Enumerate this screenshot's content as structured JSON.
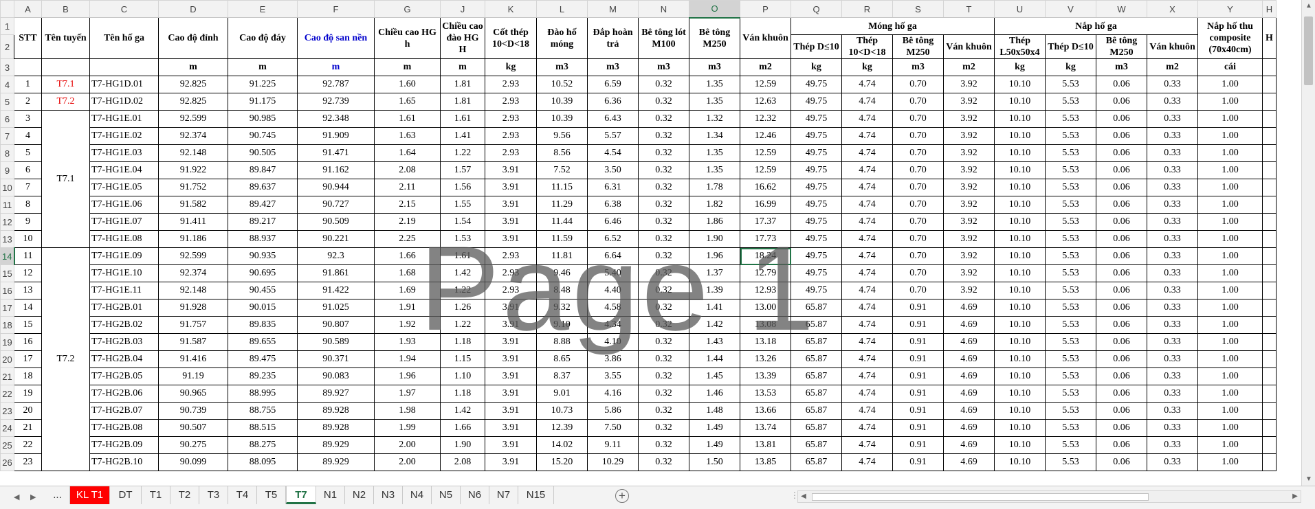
{
  "columns": [
    "A",
    "B",
    "C",
    "D",
    "E",
    "F",
    "G",
    "J",
    "K",
    "L",
    "M",
    "N",
    "O",
    "P",
    "Q",
    "R",
    "S",
    "T",
    "U",
    "V",
    "W",
    "X",
    "Y",
    "H"
  ],
  "row_numbers": [
    "1",
    "2",
    "3",
    "4",
    "5",
    "6",
    "7",
    "8",
    "9",
    "10",
    "11",
    "12",
    "13",
    "14",
    "15",
    "16",
    "17",
    "18",
    "19",
    "20",
    "21",
    "22",
    "23",
    "24",
    "25",
    "26"
  ],
  "header": {
    "stt": "STT",
    "ten_tuyen": "Tên tuyến",
    "ten_ho_ga": "Tên hố ga",
    "cao_do_dinh": "Cao độ đỉnh",
    "cao_do_day": "Cao độ đáy",
    "cao_do_san_nen": "Cao độ san nền",
    "chieu_cao_hg_h": "Chiều cao HG h",
    "chieu_cao_dao": "Chiều cao đào HG H",
    "cot_thep": "Cốt thép 10<D<18",
    "dao_ho_mong": "Đào hố móng",
    "dap_hoan_tra": "Đắp hoàn trả",
    "be_tong_lot": "Bê tông lót M100",
    "be_tong_m250": "Bê tông M250",
    "van_khuon": "Ván khuôn",
    "mong_ho_ga": "Móng hố ga",
    "nap_ho_ga": "Nắp hố ga",
    "nap_ho_thu": "Nắp hố thu composite (70x40cm)",
    "extra_h": "H",
    "sub_mong": [
      "Thép D≤10",
      "Thép 10<D<18",
      "Bê tông M250",
      "Ván khuôn"
    ],
    "sub_nap": [
      "Thép L50x50x4",
      "Thép D≤10",
      "Bê tông M250",
      "Ván khuôn"
    ]
  },
  "units": [
    "",
    "",
    "",
    "m",
    "m",
    "m",
    "m",
    "m",
    "kg",
    "m3",
    "m3",
    "m3",
    "m3",
    "m2",
    "kg",
    "kg",
    "m3",
    "m2",
    "kg",
    "kg",
    "m3",
    "m2",
    "cái"
  ],
  "groups": [
    {
      "label": "T7.1",
      "red": true,
      "start": 0,
      "span": 1
    },
    {
      "label": "T7.2",
      "red": true,
      "start": 1,
      "span": 1
    },
    {
      "label": "T7.1",
      "red": false,
      "start": 2,
      "span": 8
    },
    {
      "label": "T7.2",
      "red": false,
      "start": 10,
      "span": 13
    }
  ],
  "rows": [
    [
      "1",
      "T7-HG1D.01",
      "92.825",
      "91.225",
      "92.787",
      "1.60",
      "1.81",
      "2.93",
      "10.52",
      "6.59",
      "0.32",
      "1.35",
      "12.59",
      "49.75",
      "4.74",
      "0.70",
      "3.92",
      "10.10",
      "5.53",
      "0.06",
      "0.33",
      "1.00"
    ],
    [
      "2",
      "T7-HG1D.02",
      "92.825",
      "91.175",
      "92.739",
      "1.65",
      "1.81",
      "2.93",
      "10.39",
      "6.36",
      "0.32",
      "1.35",
      "12.63",
      "49.75",
      "4.74",
      "0.70",
      "3.92",
      "10.10",
      "5.53",
      "0.06",
      "0.33",
      "1.00"
    ],
    [
      "3",
      "T7-HG1E.01",
      "92.599",
      "90.985",
      "92.348",
      "1.61",
      "1.61",
      "2.93",
      "10.39",
      "6.43",
      "0.32",
      "1.32",
      "12.32",
      "49.75",
      "4.74",
      "0.70",
      "3.92",
      "10.10",
      "5.53",
      "0.06",
      "0.33",
      "1.00"
    ],
    [
      "4",
      "T7-HG1E.02",
      "92.374",
      "90.745",
      "91.909",
      "1.63",
      "1.41",
      "2.93",
      "9.56",
      "5.57",
      "0.32",
      "1.34",
      "12.46",
      "49.75",
      "4.74",
      "0.70",
      "3.92",
      "10.10",
      "5.53",
      "0.06",
      "0.33",
      "1.00"
    ],
    [
      "5",
      "T7-HG1E.03",
      "92.148",
      "90.505",
      "91.471",
      "1.64",
      "1.22",
      "2.93",
      "8.56",
      "4.54",
      "0.32",
      "1.35",
      "12.59",
      "49.75",
      "4.74",
      "0.70",
      "3.92",
      "10.10",
      "5.53",
      "0.06",
      "0.33",
      "1.00"
    ],
    [
      "6",
      "T7-HG1E.04",
      "91.922",
      "89.847",
      "91.162",
      "2.08",
      "1.57",
      "3.91",
      "7.52",
      "3.50",
      "0.32",
      "1.35",
      "12.59",
      "49.75",
      "4.74",
      "0.70",
      "3.92",
      "10.10",
      "5.53",
      "0.06",
      "0.33",
      "1.00"
    ],
    [
      "7",
      "T7-HG1E.05",
      "91.752",
      "89.637",
      "90.944",
      "2.11",
      "1.56",
      "3.91",
      "11.15",
      "6.31",
      "0.32",
      "1.78",
      "16.62",
      "49.75",
      "4.74",
      "0.70",
      "3.92",
      "10.10",
      "5.53",
      "0.06",
      "0.33",
      "1.00"
    ],
    [
      "8",
      "T7-HG1E.06",
      "91.582",
      "89.427",
      "90.727",
      "2.15",
      "1.55",
      "3.91",
      "11.29",
      "6.38",
      "0.32",
      "1.82",
      "16.99",
      "49.75",
      "4.74",
      "0.70",
      "3.92",
      "10.10",
      "5.53",
      "0.06",
      "0.33",
      "1.00"
    ],
    [
      "9",
      "T7-HG1E.07",
      "91.411",
      "89.217",
      "90.509",
      "2.19",
      "1.54",
      "3.91",
      "11.44",
      "6.46",
      "0.32",
      "1.86",
      "17.37",
      "49.75",
      "4.74",
      "0.70",
      "3.92",
      "10.10",
      "5.53",
      "0.06",
      "0.33",
      "1.00"
    ],
    [
      "10",
      "T7-HG1E.08",
      "91.186",
      "88.937",
      "90.221",
      "2.25",
      "1.53",
      "3.91",
      "11.59",
      "6.52",
      "0.32",
      "1.90",
      "17.73",
      "49.75",
      "4.74",
      "0.70",
      "3.92",
      "10.10",
      "5.53",
      "0.06",
      "0.33",
      "1.00"
    ],
    [
      "11",
      "T7-HG1E.09",
      "92.599",
      "90.935",
      "92.3",
      "1.66",
      "1.61",
      "2.93",
      "11.81",
      "6.64",
      "0.32",
      "1.96",
      "18.24",
      "49.75",
      "4.74",
      "0.70",
      "3.92",
      "10.10",
      "5.53",
      "0.06",
      "0.33",
      "1.00"
    ],
    [
      "12",
      "T7-HG1E.10",
      "92.374",
      "90.695",
      "91.861",
      "1.68",
      "1.42",
      "2.93",
      "9.46",
      "5.40",
      "0.32",
      "1.37",
      "12.79",
      "49.75",
      "4.74",
      "0.70",
      "3.92",
      "10.10",
      "5.53",
      "0.06",
      "0.33",
      "1.00"
    ],
    [
      "13",
      "T7-HG1E.11",
      "92.148",
      "90.455",
      "91.422",
      "1.69",
      "1.22",
      "2.93",
      "8.48",
      "4.40",
      "0.32",
      "1.39",
      "12.93",
      "49.75",
      "4.74",
      "0.70",
      "3.92",
      "10.10",
      "5.53",
      "0.06",
      "0.33",
      "1.00"
    ],
    [
      "14",
      "T7-HG2B.01",
      "91.928",
      "90.015",
      "91.025",
      "1.91",
      "1.26",
      "3.91",
      "9.32",
      "4.58",
      "0.32",
      "1.41",
      "13.00",
      "65.87",
      "4.74",
      "0.91",
      "4.69",
      "10.10",
      "5.53",
      "0.06",
      "0.33",
      "1.00"
    ],
    [
      "15",
      "T7-HG2B.02",
      "91.757",
      "89.835",
      "90.807",
      "1.92",
      "1.22",
      "3.91",
      "9.10",
      "4.34",
      "0.32",
      "1.42",
      "13.08",
      "65.87",
      "4.74",
      "0.91",
      "4.69",
      "10.10",
      "5.53",
      "0.06",
      "0.33",
      "1.00"
    ],
    [
      "16",
      "T7-HG2B.03",
      "91.587",
      "89.655",
      "90.589",
      "1.93",
      "1.18",
      "3.91",
      "8.88",
      "4.10",
      "0.32",
      "1.43",
      "13.18",
      "65.87",
      "4.74",
      "0.91",
      "4.69",
      "10.10",
      "5.53",
      "0.06",
      "0.33",
      "1.00"
    ],
    [
      "17",
      "T7-HG2B.04",
      "91.416",
      "89.475",
      "90.371",
      "1.94",
      "1.15",
      "3.91",
      "8.65",
      "3.86",
      "0.32",
      "1.44",
      "13.26",
      "65.87",
      "4.74",
      "0.91",
      "4.69",
      "10.10",
      "5.53",
      "0.06",
      "0.33",
      "1.00"
    ],
    [
      "18",
      "T7-HG2B.05",
      "91.19",
      "89.235",
      "90.083",
      "1.96",
      "1.10",
      "3.91",
      "8.37",
      "3.55",
      "0.32",
      "1.45",
      "13.39",
      "65.87",
      "4.74",
      "0.91",
      "4.69",
      "10.10",
      "5.53",
      "0.06",
      "0.33",
      "1.00"
    ],
    [
      "19",
      "T7-HG2B.06",
      "90.965",
      "88.995",
      "89.927",
      "1.97",
      "1.18",
      "3.91",
      "9.01",
      "4.16",
      "0.32",
      "1.46",
      "13.53",
      "65.87",
      "4.74",
      "0.91",
      "4.69",
      "10.10",
      "5.53",
      "0.06",
      "0.33",
      "1.00"
    ],
    [
      "20",
      "T7-HG2B.07",
      "90.739",
      "88.755",
      "89.928",
      "1.98",
      "1.42",
      "3.91",
      "10.73",
      "5.86",
      "0.32",
      "1.48",
      "13.66",
      "65.87",
      "4.74",
      "0.91",
      "4.69",
      "10.10",
      "5.53",
      "0.06",
      "0.33",
      "1.00"
    ],
    [
      "21",
      "T7-HG2B.08",
      "90.507",
      "88.515",
      "89.928",
      "1.99",
      "1.66",
      "3.91",
      "12.39",
      "7.50",
      "0.32",
      "1.49",
      "13.74",
      "65.87",
      "4.74",
      "0.91",
      "4.69",
      "10.10",
      "5.53",
      "0.06",
      "0.33",
      "1.00"
    ],
    [
      "22",
      "T7-HG2B.09",
      "90.275",
      "88.275",
      "89.929",
      "2.00",
      "1.90",
      "3.91",
      "14.02",
      "9.11",
      "0.32",
      "1.49",
      "13.81",
      "65.87",
      "4.74",
      "0.91",
      "4.69",
      "10.10",
      "5.53",
      "0.06",
      "0.33",
      "1.00"
    ],
    [
      "23",
      "T7-HG2B.10",
      "90.099",
      "88.095",
      "89.929",
      "2.00",
      "2.08",
      "3.91",
      "15.20",
      "10.29",
      "0.32",
      "1.50",
      "13.85",
      "65.87",
      "4.74",
      "0.91",
      "4.69",
      "10.10",
      "5.53",
      "0.06",
      "0.33",
      "1.00"
    ]
  ],
  "watermark": "Page 1",
  "selected": {
    "column": "O",
    "row": "14"
  },
  "sheet_tabs": [
    {
      "label": "...",
      "style": "plain"
    },
    {
      "label": "KL T1",
      "style": "red"
    },
    {
      "label": "DT",
      "style": "plain"
    },
    {
      "label": "T1",
      "style": "plain"
    },
    {
      "label": "T2",
      "style": "plain"
    },
    {
      "label": "T3",
      "style": "plain"
    },
    {
      "label": "T4",
      "style": "plain"
    },
    {
      "label": "T5",
      "style": "plain"
    },
    {
      "label": "T7",
      "style": "active"
    },
    {
      "label": "N1",
      "style": "plain"
    },
    {
      "label": "N2",
      "style": "plain"
    },
    {
      "label": "N3",
      "style": "plain"
    },
    {
      "label": "N4",
      "style": "plain"
    },
    {
      "label": "N5",
      "style": "plain"
    },
    {
      "label": "N6",
      "style": "plain"
    },
    {
      "label": "N7",
      "style": "plain"
    },
    {
      "label": "N15",
      "style": "plain"
    }
  ],
  "colors": {
    "accent": "#217346",
    "red_tab": "#ff0000",
    "blue_header": "#0000cc",
    "red_text": "#e60000"
  }
}
